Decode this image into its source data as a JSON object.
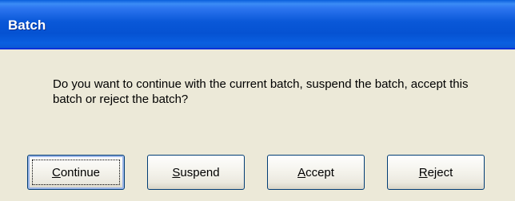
{
  "dialog": {
    "title": "Batch",
    "message": "Do you want to continue with the current batch, suspend the batch, accept this batch or reject the batch?"
  },
  "buttons": [
    {
      "id": "continue",
      "mnemonic": "C",
      "rest": "ontinue",
      "default": true
    },
    {
      "id": "suspend",
      "mnemonic": "S",
      "rest": "uspend",
      "default": false
    },
    {
      "id": "accept",
      "mnemonic": "A",
      "rest": "ccept",
      "default": false
    },
    {
      "id": "reject",
      "mnemonic": "R",
      "rest": "eject",
      "default": false
    }
  ],
  "colors": {
    "titlebar": "#0a58d8",
    "dialog_bg": "#ece9d8",
    "button_border": "#003c74"
  }
}
